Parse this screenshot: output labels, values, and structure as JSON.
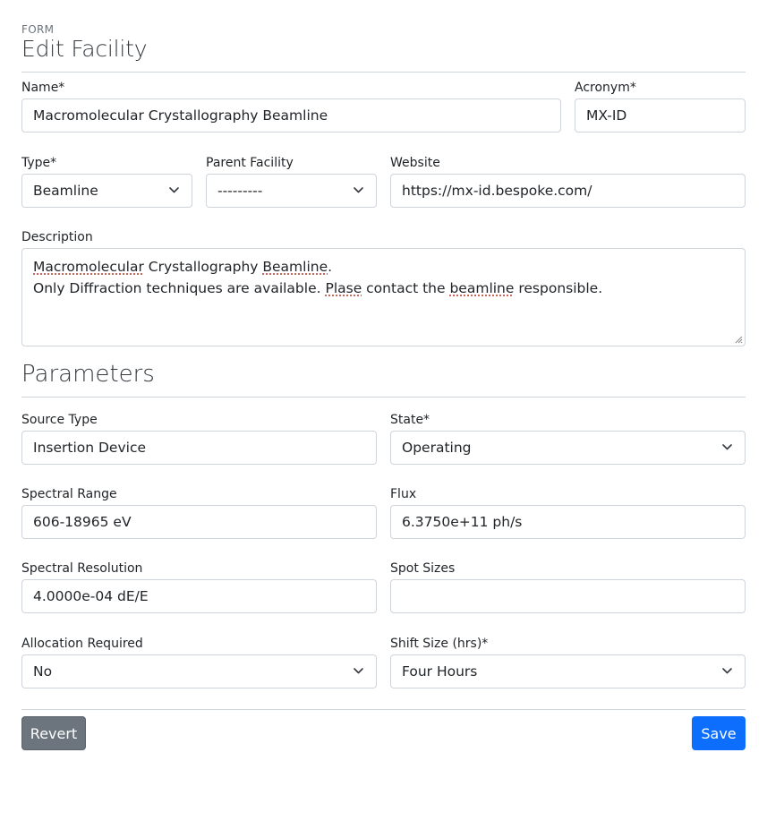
{
  "header": {
    "kicker": "FORM",
    "title": "Edit Facility"
  },
  "fields": {
    "name": {
      "label": "Name*",
      "value": "Macromolecular Crystallography Beamline"
    },
    "acronym": {
      "label": "Acronym*",
      "value": "MX-ID"
    },
    "type": {
      "label": "Type*",
      "value": "Beamline"
    },
    "parent": {
      "label": "Parent Facility",
      "value": "---------"
    },
    "website": {
      "label": "Website",
      "value": "https://mx-id.bespoke.com/"
    },
    "description": {
      "label": "Description",
      "line1": {
        "w1": "Macromolecular",
        "w2": " Crystallography ",
        "w3": "Beamline",
        "w4": "."
      },
      "line2": {
        "w1": "Only Diffraction techniques are available. ",
        "w2": "Plase",
        "w3": " contact the ",
        "w4": "beamline",
        "w5": " responsible."
      }
    }
  },
  "parameters": {
    "heading": "Parameters",
    "source_type": {
      "label": "Source Type",
      "value": "Insertion Device"
    },
    "state": {
      "label": "State*",
      "value": "Operating"
    },
    "spectral_range": {
      "label": "Spectral Range",
      "value": "606-18965 eV"
    },
    "flux": {
      "label": "Flux",
      "value": "6.3750e+11 ph/s"
    },
    "spectral_resolution": {
      "label": "Spectral Resolution",
      "value": "4.0000e-04 dE/E"
    },
    "spot_sizes": {
      "label": "Spot Sizes",
      "value": ""
    },
    "allocation_required": {
      "label": "Allocation Required",
      "value": "No"
    },
    "shift_size": {
      "label": "Shift Size (hrs)*",
      "value": "Four Hours"
    }
  },
  "actions": {
    "revert_label": "Revert",
    "save_label": "Save"
  },
  "colors": {
    "primary": "#0d6efd",
    "secondary": "#6c757d",
    "border": "#ced4da"
  },
  "icons": {
    "select": "chevron-down-icon",
    "resize": "resize-handle-icon"
  }
}
